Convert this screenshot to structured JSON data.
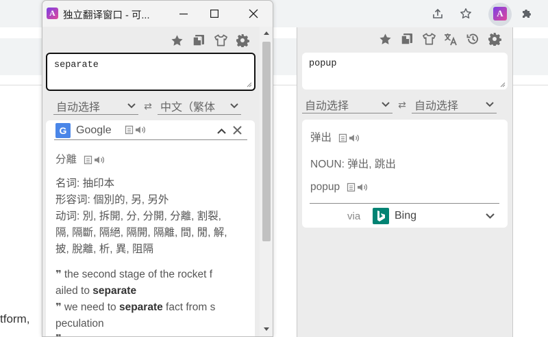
{
  "browser": {
    "background_text": "tform,"
  },
  "window": {
    "title": "独立翻译窗口 - 可...",
    "input_value": "separate",
    "source_lang": "自动选择",
    "target_lang": "中文（繁体",
    "engine_name": "Google",
    "main_translation": "分離",
    "definitions": [
      "名词: 抽印本",
      "形容词: 個別的, 另, 另外",
      "动词: 別, 拆開, 分, 分開, 分離, 割裂,",
      "隔, 隔斷, 隔絕, 隔開, 隔離, 間, 閒, 解,",
      "披, 脫離, 析, 異, 阻隔"
    ],
    "examples": [
      {
        "pre": "the second stage of the rocket f",
        "line2_pre": "ailed to ",
        "bold": "separate",
        "post": ""
      },
      {
        "pre": "we need to ",
        "bold": "separate",
        "post": " fact from s",
        "line2_pre": "peculation"
      }
    ]
  },
  "popup": {
    "input_value": "popup",
    "source_lang": "自动选择",
    "target_lang": "自动选择",
    "main_translation": "弹出",
    "pos_line": "NOUN: 弹出, 跳出",
    "source_word": "popup",
    "via_label": "via",
    "engine_name": "Bing"
  },
  "colors": {
    "bing_teal": "#008373",
    "accent": "#7b3fe4"
  }
}
